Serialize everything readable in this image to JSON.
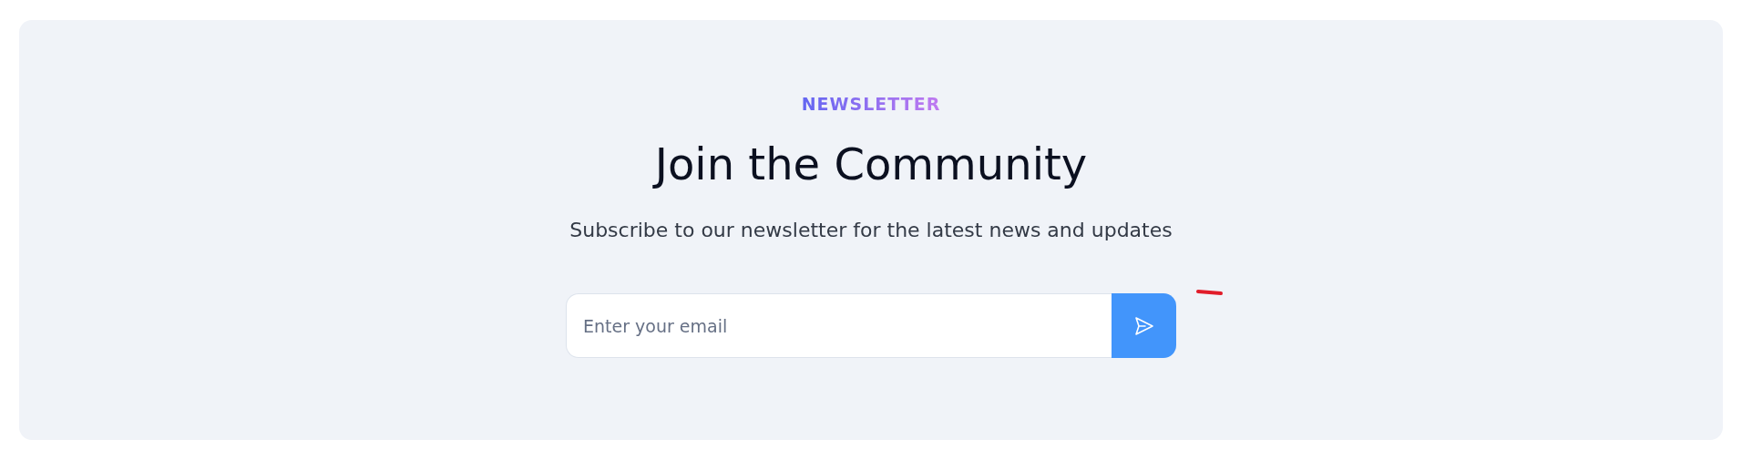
{
  "eyebrow": "NEWSLETTER",
  "title": "Join the Community",
  "subtitle": "Subscribe to our newsletter for the latest news and updates",
  "email_field": {
    "placeholder": "Enter your email"
  }
}
